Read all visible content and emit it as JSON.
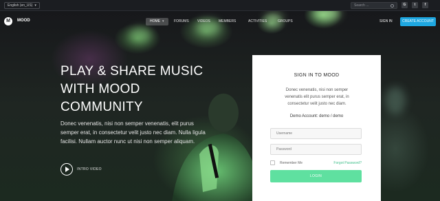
{
  "topbar": {
    "language": "English (en_US)",
    "search_placeholder": "Search ...",
    "social": [
      {
        "name": "google-plus-icon",
        "glyph": "G"
      },
      {
        "name": "twitter-icon",
        "glyph": "t"
      },
      {
        "name": "facebook-icon",
        "glyph": "f"
      }
    ]
  },
  "header": {
    "logo_letter": "M",
    "logo_text": "MOOD",
    "nav": [
      {
        "label": "HOME",
        "active": true
      },
      {
        "label": "FORUMS"
      },
      {
        "label": "VIDEOS"
      },
      {
        "label": "MEMBERS"
      },
      {
        "label": "ACTIVITIES"
      },
      {
        "label": "GROUPS"
      }
    ],
    "signin": "SIGN IN",
    "create_account": "CREATE ACCOUNT"
  },
  "hero": {
    "headline_lines": [
      "PLAY & SHARE MUSIC",
      "WITH MOOD",
      "COMMUNITY"
    ],
    "description": "Donec venenatis, nisi non semper venenatis, elit purus semper erat, in consectetur velit justo nec diam. Nulla ligula facilisi. Nullam auctor nunc ut nisi non semper aliquam.",
    "video_label": "INTRO VIDEO"
  },
  "signin_card": {
    "title": "SIGN IN TO MOOD",
    "description": "Donec venenatis, nisi non semper venenatis elit purus semper erat, in consectetur velit justo nec diam.",
    "demo": "Demo Account: demo / demo",
    "username_placeholder": "Username",
    "password_placeholder": "Password",
    "remember": "Remember Me",
    "forgot": "Forgot Password?",
    "login_button": "LOGIN"
  },
  "colors": {
    "accent_blue": "#1ea7e1",
    "login_green": "#5fe0a0",
    "link_green": "#3fbf8a"
  }
}
